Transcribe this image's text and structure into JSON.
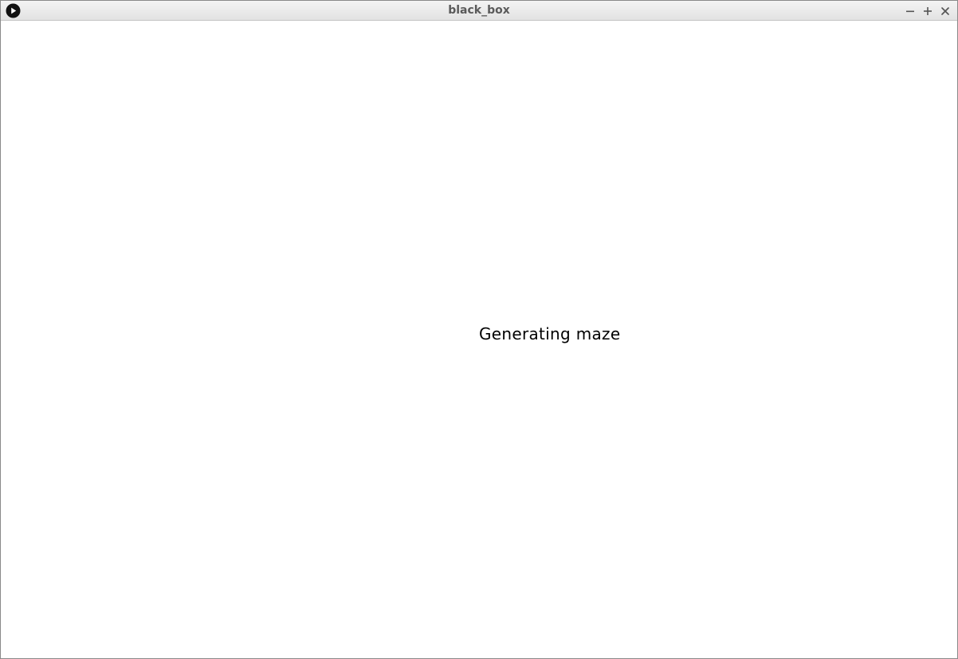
{
  "window": {
    "title": "black_box",
    "icons": {
      "app": "play-icon",
      "minimize": "minimize-icon",
      "maximize": "maximize-icon",
      "close": "close-icon"
    }
  },
  "content": {
    "status": "Generating maze"
  },
  "colors": {
    "background": "#ffffff",
    "titlebar": "#e8e8e8",
    "title_text": "#5a5a5a",
    "status_text": "#000000"
  }
}
